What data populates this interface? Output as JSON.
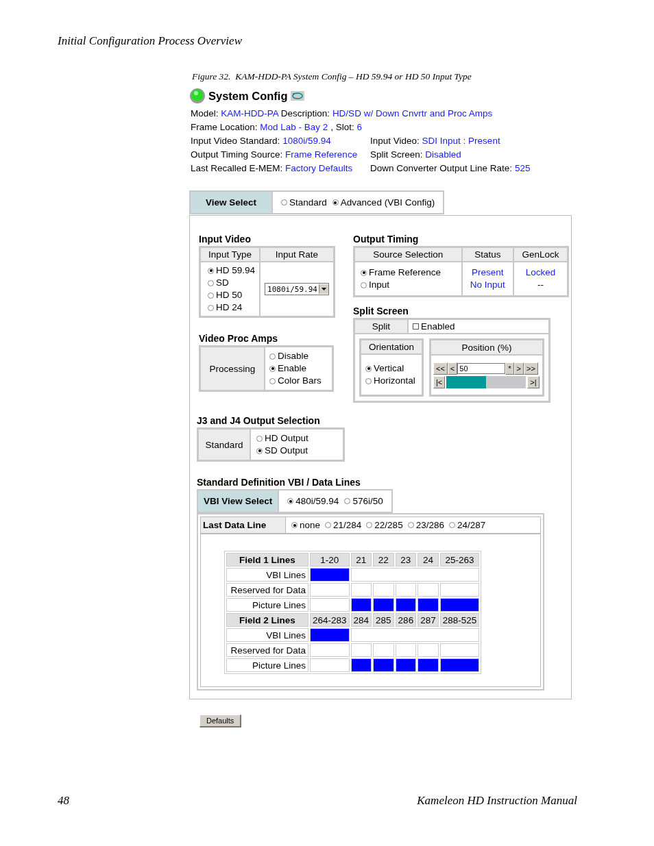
{
  "page_header": "Initial Configuration Process Overview",
  "figure_caption": "Figure 32.  KAM-HDD-PA System Config – HD 59.94 or HD 50 Input Type",
  "screen": {
    "title": "System Config",
    "info_lines": [
      [
        {
          "label": "Model:",
          "value": "KAM-HDD-PA"
        },
        {
          "label": "Description:",
          "value": "HD/SD w/ Down Cnvrtr and Proc Amps"
        }
      ],
      [
        {
          "label": "Frame Location:",
          "value": "Mod Lab - Bay 2"
        },
        {
          "label": ", Slot:",
          "value": "6"
        }
      ]
    ],
    "info_grid": [
      [
        {
          "label": "Input Video Standard:",
          "value": "1080i/59.94"
        },
        {
          "label": "Input Video:",
          "value": "SDI Input : Present"
        }
      ],
      [
        {
          "label": "Output Timing Source:",
          "value": "Frame Reference"
        },
        {
          "label": "Split Screen:",
          "value": "Disabled"
        }
      ],
      [
        {
          "label": "Last Recalled E-MEM:",
          "value": "Factory Defaults"
        },
        {
          "label": "Down Converter Output Line Rate:",
          "value": "525"
        }
      ]
    ],
    "view_select": {
      "label": "View Select",
      "options": [
        {
          "label": "Standard",
          "selected": false
        },
        {
          "label": "Advanced (VBI Config)",
          "selected": true
        }
      ]
    },
    "input_video": {
      "title": "Input Video",
      "columns": [
        "Input Type",
        "Input Rate"
      ],
      "types": [
        {
          "label": "HD 59.94",
          "selected": true
        },
        {
          "label": "SD",
          "selected": false
        },
        {
          "label": "HD 50",
          "selected": false
        },
        {
          "label": "HD 24",
          "selected": false
        }
      ],
      "rate": "1080i/59.94"
    },
    "video_proc_amps": {
      "title": "Video Proc Amps",
      "label": "Processing",
      "options": [
        {
          "label": "Disable",
          "selected": false
        },
        {
          "label": "Enable",
          "selected": true
        },
        {
          "label": "Color Bars",
          "selected": false
        }
      ]
    },
    "output_timing": {
      "title": "Output Timing",
      "columns": [
        "Source Selection",
        "Status",
        "GenLock"
      ],
      "rows": [
        {
          "source": "Frame Reference",
          "selected": true,
          "status": "Present",
          "genlock": "Locked",
          "genlock_active": true
        },
        {
          "source": "Input",
          "selected": false,
          "status": "No Input",
          "genlock": "--",
          "genlock_active": false
        }
      ]
    },
    "split_screen": {
      "title": "Split Screen",
      "split_label": "Split",
      "enabled": {
        "label": "Enabled",
        "checked": false
      },
      "orientation": {
        "title": "Orientation",
        "options": [
          {
            "label": "Vertical",
            "selected": true
          },
          {
            "label": "Horizontal",
            "selected": false
          }
        ]
      },
      "position": {
        "title": "Position (%)",
        "value": "50",
        "level": 0.5,
        "left_buttons": [
          "<<",
          "<"
        ],
        "right_buttons": [
          "*",
          ">",
          ">>"
        ],
        "start_button": "|<",
        "end_button": ">|"
      }
    },
    "j3_j4": {
      "title": "J3 and J4 Output Selection",
      "label": "Standard",
      "options": [
        {
          "label": "HD Output",
          "selected": false
        },
        {
          "label": "SD Output",
          "selected": true
        }
      ]
    },
    "vbi": {
      "title": "Standard Definition VBI / Data Lines",
      "view_select": {
        "label": "VBI View Select",
        "options": [
          {
            "label": "480i/59.94",
            "selected": true
          },
          {
            "label": "576i/50",
            "selected": false
          }
        ]
      },
      "last_data_line": {
        "label": "Last Data Line",
        "options": [
          {
            "label": "none",
            "selected": true
          },
          {
            "label": "21/284",
            "selected": false
          },
          {
            "label": "22/285",
            "selected": false
          },
          {
            "label": "23/286",
            "selected": false
          },
          {
            "label": "24/287",
            "selected": false
          }
        ]
      },
      "fields": [
        {
          "header": "Field 1 Lines",
          "columns": [
            "1-20",
            "21",
            "22",
            "23",
            "24",
            "25-263"
          ],
          "rows": [
            {
              "label": "VBI Lines",
              "kind": "merged",
              "filled": [
                true,
                false
              ]
            },
            {
              "label": "Reserved for Data",
              "kind": "split",
              "filled": [
                false,
                false,
                false,
                false,
                false,
                false
              ]
            },
            {
              "label": "Picture Lines",
              "kind": "split",
              "filled": [
                false,
                true,
                true,
                true,
                true,
                true
              ]
            }
          ]
        },
        {
          "header": "Field 2 Lines",
          "columns": [
            "264-283",
            "284",
            "285",
            "286",
            "287",
            "288-525"
          ],
          "rows": [
            {
              "label": "VBI Lines",
              "kind": "merged",
              "filled": [
                true,
                false
              ]
            },
            {
              "label": "Reserved for Data",
              "kind": "split",
              "filled": [
                false,
                false,
                false,
                false,
                false,
                false
              ]
            },
            {
              "label": "Picture Lines",
              "kind": "split",
              "filled": [
                false,
                true,
                true,
                true,
                true,
                true
              ]
            }
          ]
        }
      ]
    },
    "defaults_button": "Defaults"
  },
  "page_footer": {
    "page_number": "48",
    "manual_title": "Kameleon HD Instruction Manual"
  }
}
